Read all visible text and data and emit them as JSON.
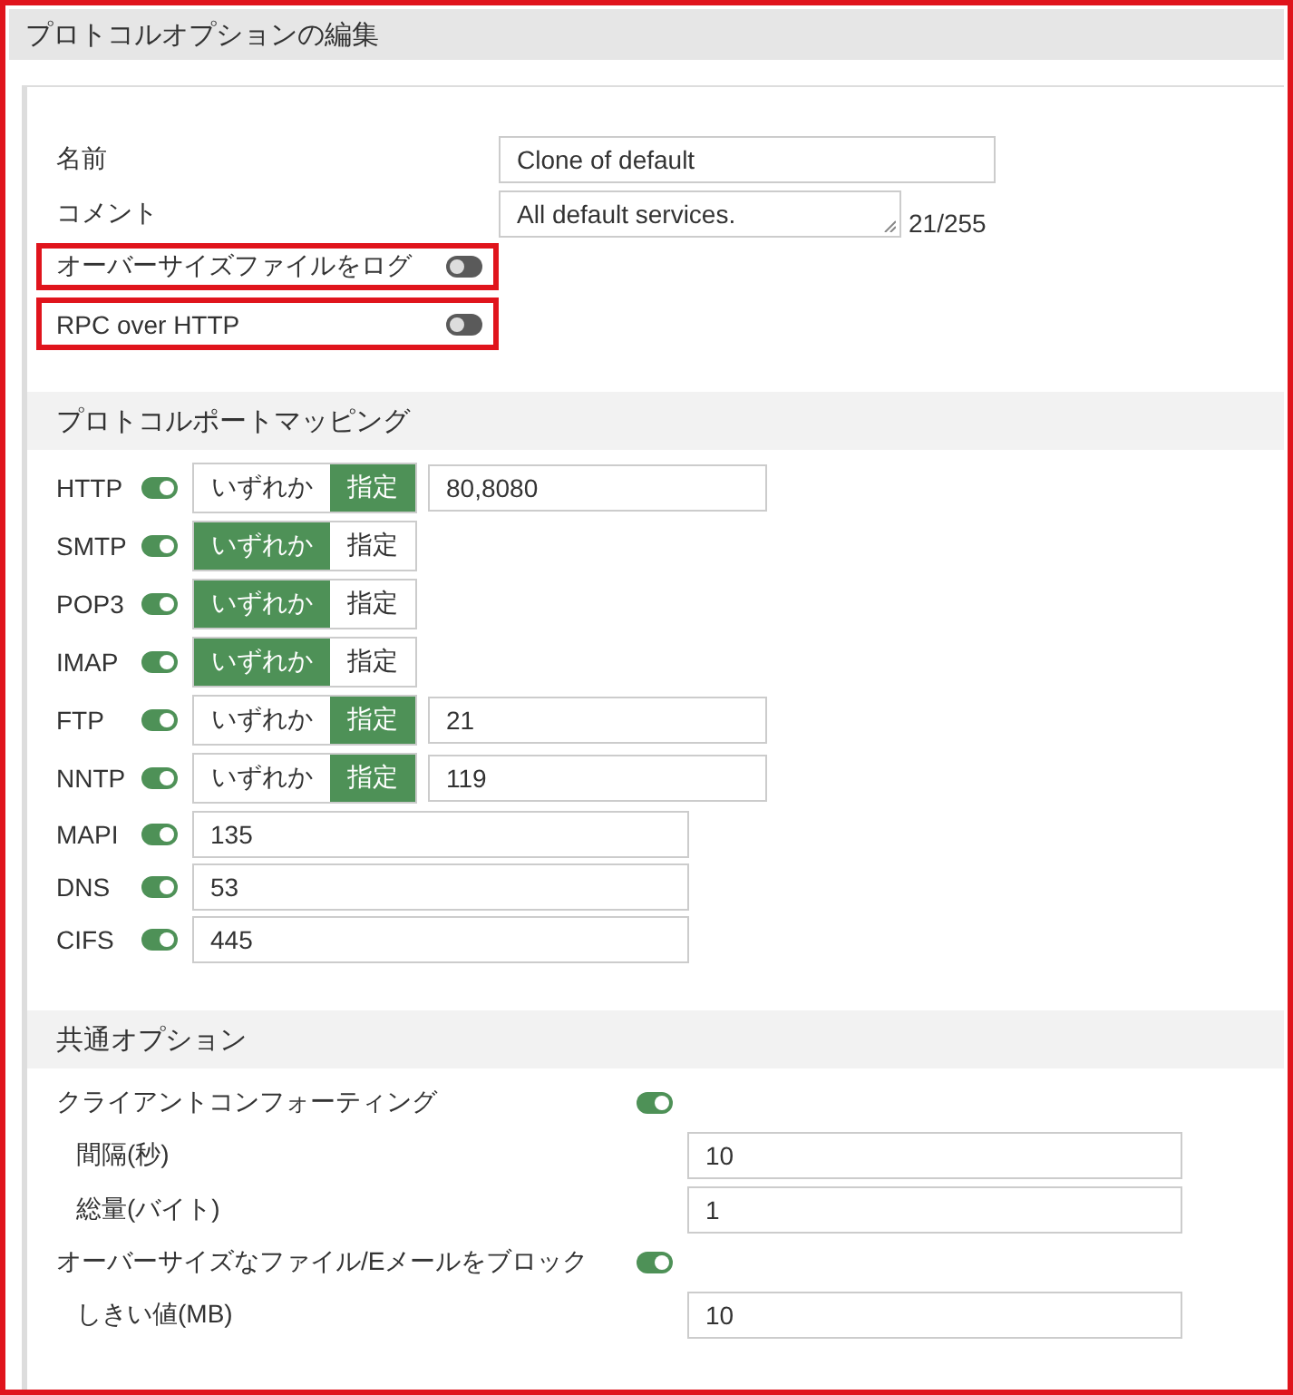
{
  "window": {
    "title": "プロトコルオプションの編集",
    "highlighted": true
  },
  "general": {
    "fields": [
      {
        "kind": "text",
        "label": "名前",
        "value": "Clone of default"
      },
      {
        "kind": "textarea",
        "label": "コメント",
        "value": "All default services.",
        "counter": "21/255"
      },
      {
        "kind": "toggle",
        "label": "オーバーサイズファイルをログ",
        "on": false,
        "highlighted": true
      },
      {
        "kind": "toggle",
        "label": "RPC over HTTP",
        "on": false,
        "highlighted": true
      }
    ]
  },
  "port_mapping": {
    "heading": "プロトコルポートマッピング",
    "protocols": [
      {
        "kind": "choice",
        "name": "HTTP",
        "on": true,
        "options": [
          {
            "label": "いずれか",
            "selected": false
          },
          {
            "label": "指定",
            "selected": true
          }
        ],
        "ports": "80,8080"
      },
      {
        "kind": "choice",
        "name": "SMTP",
        "on": true,
        "options": [
          {
            "label": "いずれか",
            "selected": true
          },
          {
            "label": "指定",
            "selected": false
          }
        ]
      },
      {
        "kind": "choice",
        "name": "POP3",
        "on": true,
        "options": [
          {
            "label": "いずれか",
            "selected": true
          },
          {
            "label": "指定",
            "selected": false
          }
        ]
      },
      {
        "kind": "choice",
        "name": "IMAP",
        "on": true,
        "options": [
          {
            "label": "いずれか",
            "selected": true
          },
          {
            "label": "指定",
            "selected": false
          }
        ]
      },
      {
        "kind": "choice",
        "name": "FTP",
        "on": true,
        "options": [
          {
            "label": "いずれか",
            "selected": false
          },
          {
            "label": "指定",
            "selected": true
          }
        ],
        "ports": "21"
      },
      {
        "kind": "choice",
        "name": "NNTP",
        "on": true,
        "options": [
          {
            "label": "いずれか",
            "selected": false
          },
          {
            "label": "指定",
            "selected": true
          }
        ],
        "ports": "119"
      },
      {
        "kind": "ports",
        "name": "MAPI",
        "on": true,
        "ports": "135"
      },
      {
        "kind": "ports",
        "name": "DNS",
        "on": true,
        "ports": "53"
      },
      {
        "kind": "ports",
        "name": "CIFS",
        "on": true,
        "ports": "445"
      }
    ]
  },
  "common": {
    "heading": "共通オプション",
    "options": [
      {
        "kind": "toggle",
        "label": "クライアントコンフォーティング",
        "on": true
      },
      {
        "kind": "sub",
        "label": "間隔(秒)",
        "value": "10"
      },
      {
        "kind": "sub",
        "label": "総量(バイト)",
        "value": "1"
      },
      {
        "kind": "toggle",
        "label": "オーバーサイズなファイル/Eメールをブロック",
        "on": true
      },
      {
        "kind": "sub",
        "label": "しきい値(MB)",
        "value": "10"
      }
    ]
  }
}
